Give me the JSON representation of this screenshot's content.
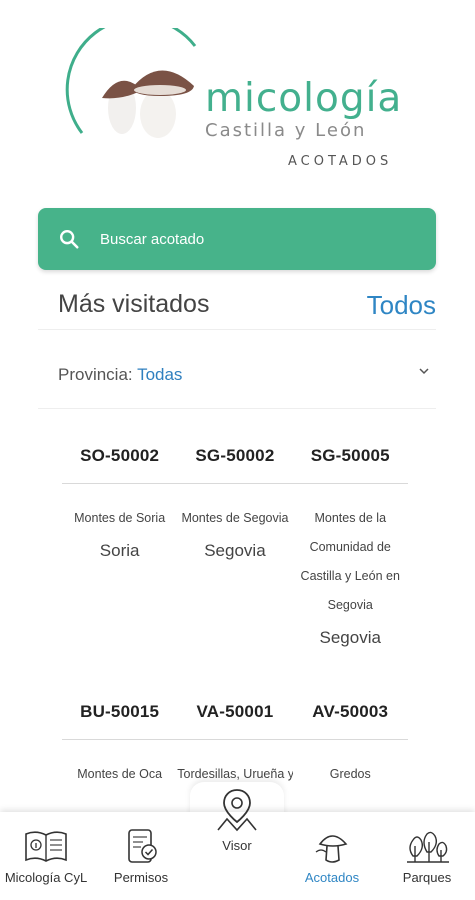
{
  "brand": {
    "title": "micología",
    "subtitle": "Castilla y León",
    "section": "ACOTADOS"
  },
  "search": {
    "placeholder": "Buscar acotado"
  },
  "most_visited": {
    "title": "Más visitados",
    "all_link": "Todos"
  },
  "province_filter": {
    "label": "Provincia: ",
    "value": "Todas"
  },
  "cards_row1": [
    {
      "code": "SO-50002",
      "name": "Montes de Soria",
      "province": "Soria"
    },
    {
      "code": "SG-50002",
      "name": "Montes de Segovia",
      "province": "Segovia"
    },
    {
      "code": "SG-50005",
      "name_lines": [
        "Montes de la",
        "Comunidad de",
        "Castilla y León en",
        "Segovia"
      ],
      "province": "Segovia"
    }
  ],
  "cards_row2": [
    {
      "code": "BU-50015",
      "name": "Montes de Oca"
    },
    {
      "code": "VA-50001",
      "name": "Tordesillas, Urueña y"
    },
    {
      "code": "AV-50003",
      "name": "Gredos"
    }
  ],
  "nav": {
    "micologia": "Micología CyL",
    "permisos": "Permisos",
    "visor": "Visor",
    "acotados": "Acotados",
    "parques": "Parques"
  },
  "colors": {
    "accent_green": "#47b38a",
    "link_blue": "#2f86c4",
    "mushroom_cap": "#7a5245"
  }
}
